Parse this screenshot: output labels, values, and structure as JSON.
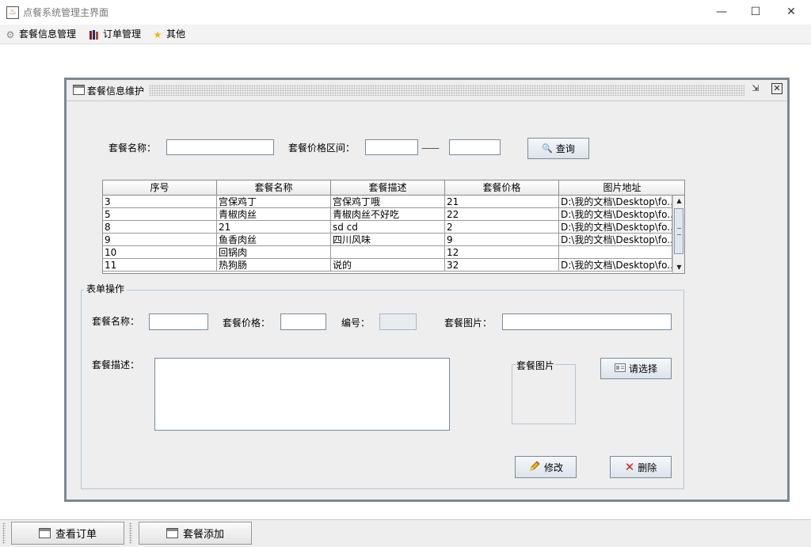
{
  "window": {
    "title": "点餐系统管理主界面",
    "minimize_glyph": "—",
    "maximize_glyph": "☐",
    "close_glyph": "✕"
  },
  "menubar": {
    "items": [
      {
        "label": "套餐信息管理",
        "icon": "gear-icon"
      },
      {
        "label": "订单管理",
        "icon": "books-icon"
      },
      {
        "label": "其他",
        "icon": "star-icon"
      }
    ]
  },
  "internal_frame": {
    "title": "套餐信息维护",
    "search": {
      "name_label": "套餐名称：",
      "name_value": "",
      "price_range_label": "套餐价格区间：",
      "price_from": "",
      "separator": "——",
      "price_to": "",
      "query_button": "查询"
    },
    "table": {
      "columns": [
        "序号",
        "套餐名称",
        "套餐描述",
        "套餐价格",
        "图片地址"
      ],
      "rows": [
        [
          "3",
          "宫保鸡丁",
          "宫保鸡丁哦",
          "21",
          "D:\\我的文档\\Desktop\\fo..."
        ],
        [
          "5",
          "青椒肉丝",
          "青椒肉丝不好吃",
          "22",
          "D:\\我的文档\\Desktop\\fo..."
        ],
        [
          "8",
          "21",
          "sd cd",
          "2",
          "D:\\我的文档\\Desktop\\fo..."
        ],
        [
          "9",
          "鱼香肉丝",
          "四川风味",
          "9",
          "D:\\我的文档\\Desktop\\fo..."
        ],
        [
          "10",
          "回锅肉",
          "",
          "12",
          ""
        ],
        [
          "11",
          "热狗肠",
          "说的",
          "32",
          "D:\\我的文档\\Desktop\\fo..."
        ]
      ]
    },
    "form": {
      "group_title": "表单操作",
      "name_label": "套餐名称：",
      "name_value": "",
      "price_label": "套餐价格：",
      "price_value": "",
      "id_label": "编号：",
      "id_value": "",
      "image_label": "套餐图片：",
      "image_value": "",
      "desc_label": "套餐描述：",
      "desc_value": "",
      "image_preview_title": "套餐图片",
      "choose_button": "请选择",
      "modify_button": "修改",
      "delete_button": "删除"
    }
  },
  "taskbar": {
    "items": [
      {
        "label": "查看订单"
      },
      {
        "label": "套餐添加"
      }
    ]
  }
}
